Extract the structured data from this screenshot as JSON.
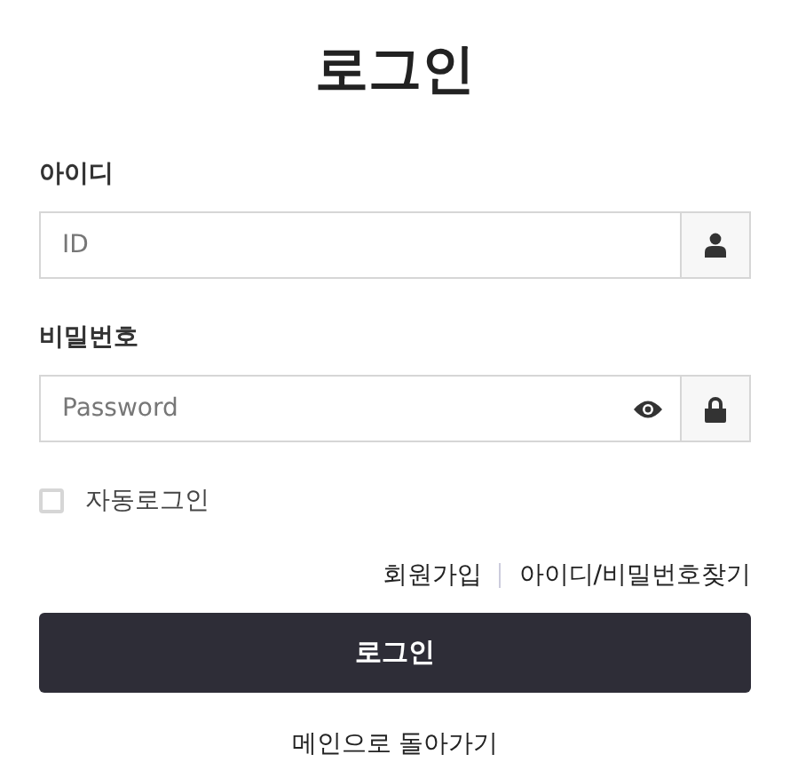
{
  "title": "로그인",
  "fields": [
    {
      "label": "아이디",
      "placeholder": "ID",
      "kind": "text"
    },
    {
      "label": "비밀번호",
      "placeholder": "Password",
      "kind": "password"
    }
  ],
  "auto_login": {
    "label": "자동로그인",
    "checked": false
  },
  "links": [
    "회원가입",
    "아이디/비밀번호찾기"
  ],
  "submit": "로그인",
  "back_link": "메인으로 돌아가기"
}
